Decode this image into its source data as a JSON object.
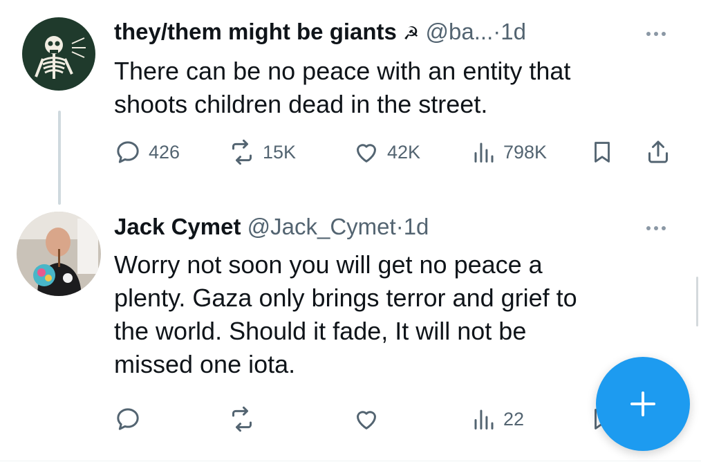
{
  "tweets": [
    {
      "name": "they/them might be giants",
      "badge": "☭",
      "handle": "@ba...",
      "separator": "·",
      "time": "1d",
      "text_lines": [
        "There can be no peace with an entity that",
        "shoots children dead in the street."
      ],
      "replies": "426",
      "reposts": "15K",
      "likes": "42K",
      "views": "798K"
    },
    {
      "name": "Jack Cymet",
      "handle": "@Jack_Cymet",
      "separator": "·",
      "time": "1d",
      "text_lines": [
        "Worry not soon you will get no peace a",
        "plenty. Gaza only brings terror and grief to",
        "the world. Should it fade, It will not be",
        "missed one iota."
      ],
      "views": "22"
    }
  ],
  "fab": {
    "icon": "plus-icon"
  },
  "colors": {
    "accent": "#1d9bf0",
    "muted": "#536471",
    "text": "#0f1419"
  }
}
